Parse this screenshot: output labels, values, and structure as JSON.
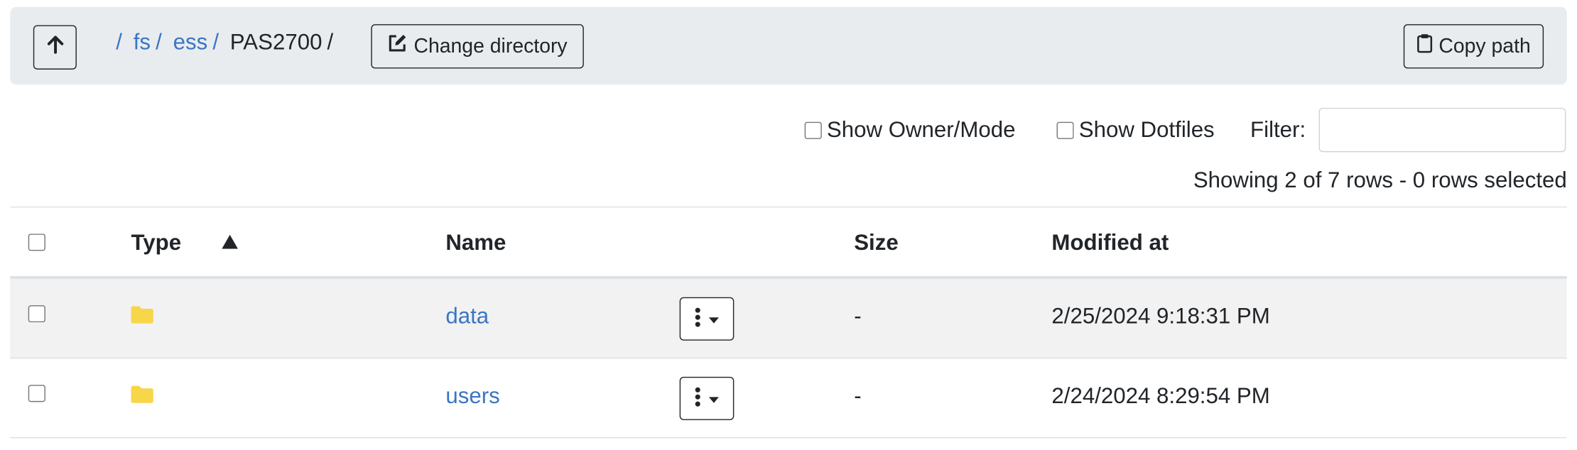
{
  "toolbar": {
    "up_icon": "arrow-up-icon",
    "breadcrumb": [
      {
        "label": "/",
        "link": true
      },
      {
        "label": "fs",
        "link": true
      },
      {
        "label": "ess",
        "link": true
      },
      {
        "label": "PAS2700",
        "link": false
      }
    ],
    "trailing_separator": "/",
    "change_directory_label": "Change directory",
    "change_directory_icon": "edit-icon",
    "copy_path_label": "Copy path",
    "copy_path_icon": "clipboard-icon"
  },
  "controls": {
    "show_owner_mode_label": "Show Owner/Mode",
    "show_owner_mode_checked": false,
    "show_dotfiles_label": "Show Dotfiles",
    "show_dotfiles_checked": false,
    "filter_label": "Filter:",
    "filter_value": ""
  },
  "status_text": "Showing 2 of 7 rows - 0 rows selected",
  "table": {
    "columns": [
      "Type",
      "Name",
      "Size",
      "Modified at"
    ],
    "sort_icon": "sort-up-icon",
    "rows": [
      {
        "type": "folder",
        "name": "data",
        "size": "-",
        "modified": "2/25/2024 9:18:31 PM"
      },
      {
        "type": "folder",
        "name": "users",
        "size": "-",
        "modified": "2/24/2024 8:29:54 PM"
      }
    ]
  },
  "colors": {
    "link": "#3a76c3",
    "folder": "#f7d64a",
    "toolbar_bg": "#e9ecef",
    "row_shade": "#f2f2f2"
  }
}
